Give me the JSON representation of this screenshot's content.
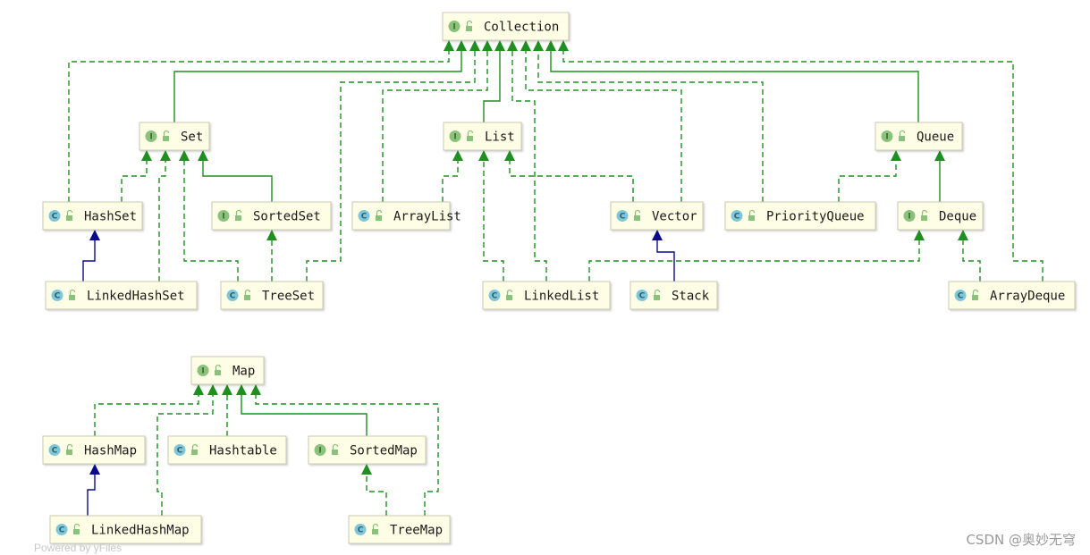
{
  "colors": {
    "implements": "#1f8f1f",
    "extends_interface": "#1f8f1f",
    "extends_class": "#0a0a8a",
    "node_fill": "#fefee6",
    "node_border": "#c9c9b2",
    "interface_badge": "#8bc27b",
    "class_badge": "#7fc6d8"
  },
  "nodes": [
    {
      "id": "Collection",
      "label": "Collection",
      "kind": "interface"
    },
    {
      "id": "Set",
      "label": "Set",
      "kind": "interface"
    },
    {
      "id": "List",
      "label": "List",
      "kind": "interface"
    },
    {
      "id": "Queue",
      "label": "Queue",
      "kind": "interface"
    },
    {
      "id": "HashSet",
      "label": "HashSet",
      "kind": "class"
    },
    {
      "id": "SortedSet",
      "label": "SortedSet",
      "kind": "interface"
    },
    {
      "id": "ArrayList",
      "label": "ArrayList",
      "kind": "class"
    },
    {
      "id": "Vector",
      "label": "Vector",
      "kind": "class"
    },
    {
      "id": "PriorityQueue",
      "label": "PriorityQueue",
      "kind": "class"
    },
    {
      "id": "Deque",
      "label": "Deque",
      "kind": "interface"
    },
    {
      "id": "LinkedHashSet",
      "label": "LinkedHashSet",
      "kind": "class"
    },
    {
      "id": "TreeSet",
      "label": "TreeSet",
      "kind": "class"
    },
    {
      "id": "LinkedList",
      "label": "LinkedList",
      "kind": "class"
    },
    {
      "id": "Stack",
      "label": "Stack",
      "kind": "class"
    },
    {
      "id": "ArrayDeque",
      "label": "ArrayDeque",
      "kind": "class"
    },
    {
      "id": "Map",
      "label": "Map",
      "kind": "interface"
    },
    {
      "id": "HashMap",
      "label": "HashMap",
      "kind": "class"
    },
    {
      "id": "Hashtable",
      "label": "Hashtable",
      "kind": "class"
    },
    {
      "id": "SortedMap",
      "label": "SortedMap",
      "kind": "interface"
    },
    {
      "id": "LinkedHashMap",
      "label": "LinkedHashMap",
      "kind": "class"
    },
    {
      "id": "TreeMap",
      "label": "TreeMap",
      "kind": "class"
    }
  ],
  "edges": [
    {
      "from": "HashSet",
      "to": "Collection",
      "kind": "implements"
    },
    {
      "from": "Set",
      "to": "Collection",
      "kind": "extends_interface"
    },
    {
      "from": "TreeSet",
      "to": "Collection",
      "kind": "implements"
    },
    {
      "from": "ArrayList",
      "to": "Collection",
      "kind": "implements"
    },
    {
      "from": "List",
      "to": "Collection",
      "kind": "extends_interface"
    },
    {
      "from": "LinkedList",
      "to": "Collection",
      "kind": "implements"
    },
    {
      "from": "Vector",
      "to": "Collection",
      "kind": "implements"
    },
    {
      "from": "PriorityQueue",
      "to": "Collection",
      "kind": "implements"
    },
    {
      "from": "Queue",
      "to": "Collection",
      "kind": "extends_interface"
    },
    {
      "from": "ArrayDeque",
      "to": "Collection",
      "kind": "implements"
    },
    {
      "from": "HashSet",
      "to": "Set",
      "kind": "implements"
    },
    {
      "from": "LinkedHashSet",
      "to": "Set",
      "kind": "implements"
    },
    {
      "from": "TreeSet",
      "to": "Set",
      "kind": "implements"
    },
    {
      "from": "SortedSet",
      "to": "Set",
      "kind": "extends_interface"
    },
    {
      "from": "TreeSet",
      "to": "SortedSet",
      "kind": "implements"
    },
    {
      "from": "LinkedHashSet",
      "to": "HashSet",
      "kind": "extends_class"
    },
    {
      "from": "ArrayList",
      "to": "List",
      "kind": "implements"
    },
    {
      "from": "LinkedList",
      "to": "List",
      "kind": "implements"
    },
    {
      "from": "Vector",
      "to": "List",
      "kind": "implements"
    },
    {
      "from": "Stack",
      "to": "Vector",
      "kind": "extends_class"
    },
    {
      "from": "PriorityQueue",
      "to": "Queue",
      "kind": "implements"
    },
    {
      "from": "Deque",
      "to": "Queue",
      "kind": "extends_interface"
    },
    {
      "from": "LinkedList",
      "to": "Deque",
      "kind": "implements"
    },
    {
      "from": "ArrayDeque",
      "to": "Deque",
      "kind": "implements"
    },
    {
      "from": "HashMap",
      "to": "Map",
      "kind": "implements"
    },
    {
      "from": "LinkedHashMap",
      "to": "Map",
      "kind": "implements"
    },
    {
      "from": "Hashtable",
      "to": "Map",
      "kind": "implements"
    },
    {
      "from": "SortedMap",
      "to": "Map",
      "kind": "extends_interface"
    },
    {
      "from": "TreeMap",
      "to": "Map",
      "kind": "implements"
    },
    {
      "from": "LinkedHashMap",
      "to": "HashMap",
      "kind": "extends_class"
    },
    {
      "from": "TreeMap",
      "to": "SortedMap",
      "kind": "implements"
    }
  ],
  "footer": "Powered by yFiles",
  "watermark": "CSDN @奥妙无穹"
}
